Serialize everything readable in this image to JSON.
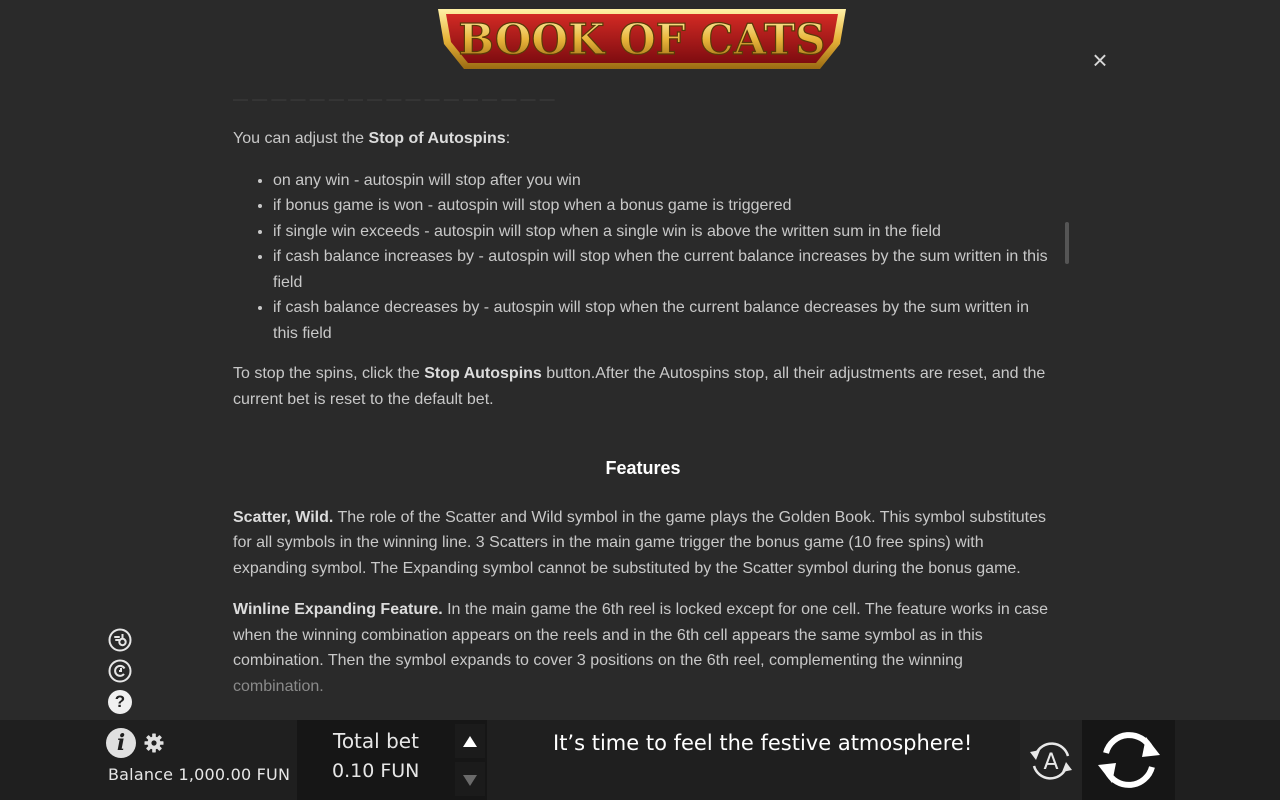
{
  "header": {
    "logo_text": "BOOK OF CATS",
    "close_label": "×"
  },
  "rules": {
    "cut_line": "— — — — — — — — — — — — — — — — —",
    "autospins_intro_pre": "You can adjust the ",
    "autospins_intro_bold": "Stop of Autospins",
    "autospins_intro_post": ":",
    "stop_options": [
      "on any win - autospin will stop after you win",
      "if bonus game is won - autospin will stop when a bonus game is triggered",
      "if single win exceeds - autospin will stop when a single win is above the written sum in the field",
      "if cash balance increases by - autospin will stop when the current balance increases by the sum written in this field",
      "if cash balance decreases by - autospin will stop when the current balance decreases by the sum written in this field"
    ],
    "stop_pre": "To stop the spins, click the ",
    "stop_bold": "Stop Autospins",
    "stop_post": " button.After the Autospins stop, all their adjustments are reset, and the current bet is reset to the default bet.",
    "features_heading": "Features",
    "scatter_bold": "Scatter, Wild.",
    "scatter_text": " The role of the Scatter and Wild symbol in the game plays the Golden Book. This symbol substitutes for all symbols in the winning line. 3 Scatters in the main game trigger the bonus game (10 free spins) with expanding symbol. The Expanding symbol cannot be substituted by the Scatter symbol during the bonus game.",
    "winline_bold": "Winline Expanding Feature.",
    "winline_text": " In the main game the 6th reel is locked except for one cell. The feature works in case when the winning combination appears on the reels and in the 6th cell appears the same symbol as in this combination. Then the symbol expands to cover 3 positions on the 6th reel, complementing the winning ",
    "winline_last": "combination."
  },
  "side_icons": [
    "bonus-buy-icon",
    "history-icon",
    "help-icon"
  ],
  "side_labels": {
    "help": "?"
  },
  "bottom": {
    "info_label": "i",
    "balance": "Balance 1,000.00 FUN",
    "total_bet_label": "Total bet",
    "total_bet_value": "0.10 FUN",
    "message": "It’s time to feel the festive atmosphere!",
    "autoplay_label": "A"
  },
  "colors": {
    "background": "#2a2a2a",
    "bottom_bar": "#1f1f1f",
    "logo_red": "#b3141c",
    "logo_gold": "#e8b43a"
  }
}
